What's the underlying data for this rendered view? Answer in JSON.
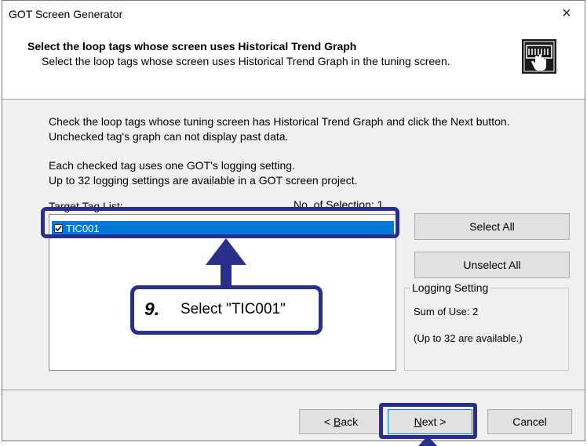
{
  "window": {
    "title": "GOT Screen Generator",
    "close_glyph": "×"
  },
  "header": {
    "title": "Select the loop tags whose screen uses Historical Trend Graph",
    "subtitle": "Select the loop tags whose screen uses Historical Trend Graph in the tuning screen.",
    "icon": "touch-screen-icon"
  },
  "instructions": {
    "line1": "Check the loop tags whose tuning screen has Historical Trend Graph and click the Next button.",
    "line2": "Unchecked tag's graph can not display past data.",
    "line3": "Each checked tag uses one GOT's logging setting.",
    "line4": "Up to 32 logging settings are available in a GOT screen project."
  },
  "tag_list": {
    "label": "Target Tag List:",
    "count_label": "No. of Selection:  1",
    "items": [
      {
        "label": "TIC001",
        "checked": true,
        "selected": true
      }
    ]
  },
  "buttons": {
    "select_all": "Select All",
    "unselect_all": "Unselect All",
    "back_prefix": "< ",
    "back_key": "B",
    "back_rest": "ack",
    "next_key": "N",
    "next_rest": "ext >",
    "cancel": "Cancel"
  },
  "logging_setting": {
    "legend": "Logging Setting",
    "sum_of_use": "Sum of Use: 2",
    "available": "(Up to 32 are available.)"
  },
  "annotation": {
    "step_number": "9.",
    "step_text": "Select \"TIC001\"",
    "color": "#2b2f8c"
  }
}
